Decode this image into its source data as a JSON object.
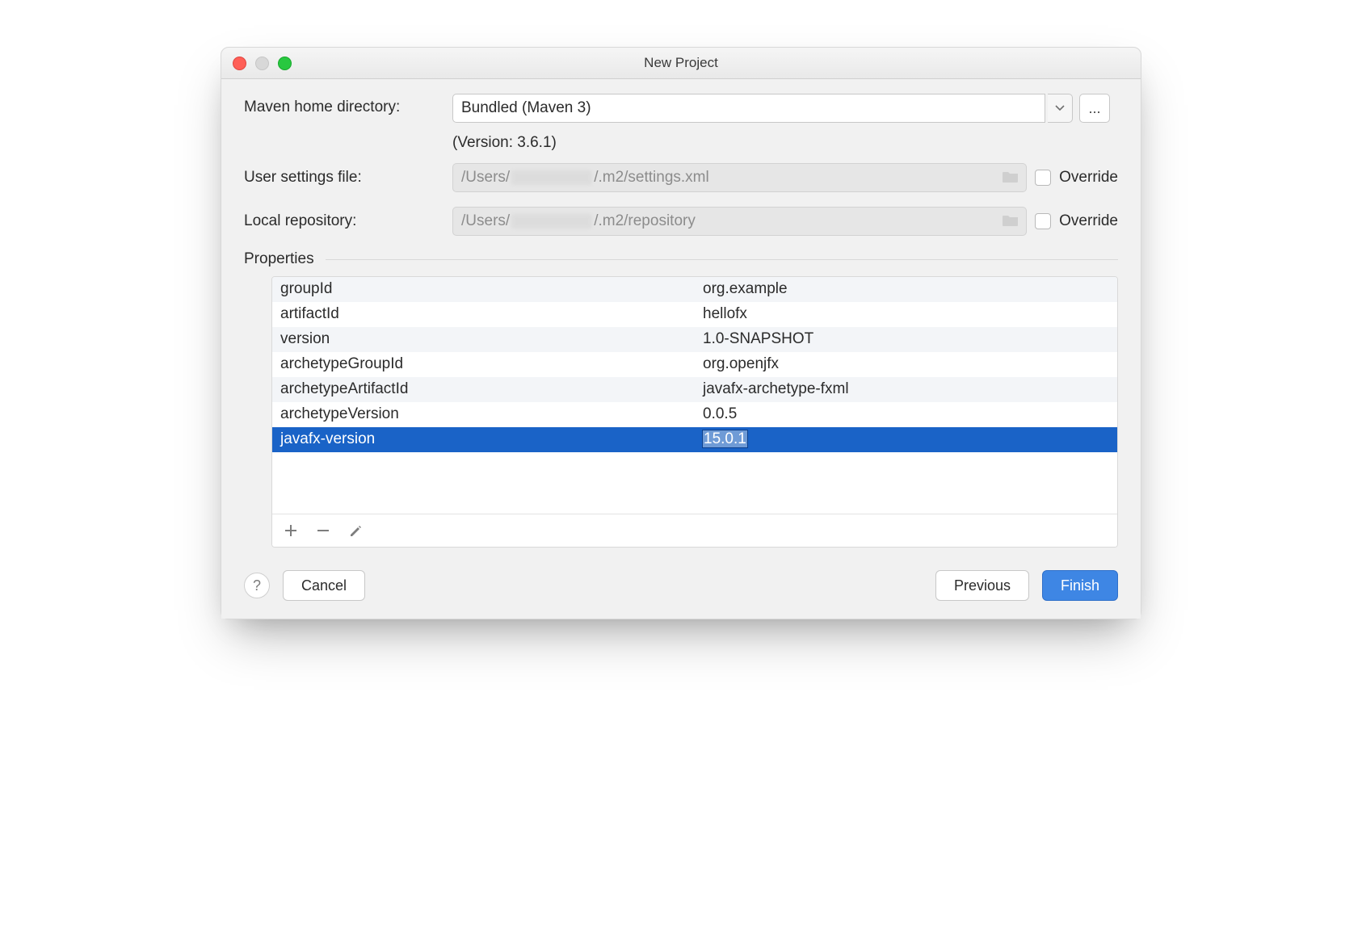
{
  "window": {
    "title": "New Project"
  },
  "form": {
    "mavenHome": {
      "label": "Maven home directory:",
      "value": "Bundled (Maven 3)",
      "version": "(Version: 3.6.1)"
    },
    "userSettings": {
      "label": "User settings file:",
      "prefix": "/Users/",
      "suffix": "/.m2/settings.xml",
      "override": "Override"
    },
    "localRepo": {
      "label": "Local repository:",
      "prefix": "/Users/",
      "suffix": "/.m2/repository",
      "override": "Override"
    },
    "moreButton": "..."
  },
  "propertiesLabel": "Properties",
  "properties": [
    {
      "key": "groupId",
      "value": "org.example"
    },
    {
      "key": "artifactId",
      "value": "hellofx"
    },
    {
      "key": "version",
      "value": "1.0-SNAPSHOT"
    },
    {
      "key": "archetypeGroupId",
      "value": "org.openjfx"
    },
    {
      "key": "archetypeArtifactId",
      "value": "javafx-archetype-fxml"
    },
    {
      "key": "archetypeVersion",
      "value": "0.0.5"
    },
    {
      "key": "javafx-version",
      "value": "15.0.1"
    }
  ],
  "selectedRowIndex": 6,
  "buttons": {
    "help": "?",
    "cancel": "Cancel",
    "previous": "Previous",
    "finish": "Finish"
  }
}
